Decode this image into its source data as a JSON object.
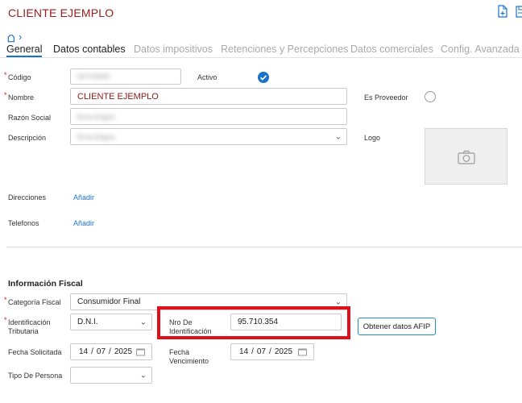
{
  "header": {
    "title": "CLIENTE EJEMPLO",
    "new_icon": "add-document-icon",
    "save_icon": "save-icon"
  },
  "breadcrumb": {
    "tag_icon": "tag-icon",
    "chevron": "›"
  },
  "tabs": [
    {
      "label": "General",
      "state": "active"
    },
    {
      "label": "Datos contables",
      "state": "enabled"
    },
    {
      "label": "Datos impositivos",
      "state": "disabled"
    },
    {
      "label": "Retenciones y Percepciones",
      "state": "disabled"
    },
    {
      "label": "Datos comerciales",
      "state": "disabled"
    },
    {
      "label": "Config. Avanzada",
      "state": "disabled"
    }
  ],
  "general": {
    "codigo": {
      "label": "Código",
      "value": "00723059"
    },
    "activo": {
      "label": "Activo",
      "checked": true
    },
    "nombre": {
      "label": "Nombre",
      "value": "CLIENTE EJEMPLO"
    },
    "es_proveedor": {
      "label": "Es Proveedor",
      "checked": false
    },
    "razon_social": {
      "label": "Razón Social",
      "value": "Ema Edgon"
    },
    "descripcion": {
      "label": "Descripción",
      "value": "Ema Edgon"
    },
    "logo": {
      "label": "Logo",
      "icon": "camera-icon"
    },
    "direcciones": {
      "label": "Direcciones",
      "action": "Añadir"
    },
    "telefonos": {
      "label": "Telefonos",
      "action": "Añadir"
    }
  },
  "fiscal": {
    "section_title": "Información Fiscal",
    "categoria": {
      "label": "Categoría Fiscal",
      "value": "Consumidor Final"
    },
    "identificacion": {
      "label_line1": "Identificación",
      "label_line2": "Tributaria",
      "value": "D.N.I."
    },
    "nro_identificacion": {
      "label_line1": "Nro De",
      "label_line2": "Identificación",
      "value": "95.710.354"
    },
    "afip_button": "Obtener datos AFIP",
    "fecha_solicitada": {
      "label": "Fecha Solicitada",
      "day": "14",
      "month": "07",
      "year": "2025"
    },
    "fecha_vencimiento": {
      "label_line1": "Fecha",
      "label_line2": "Vencimiento",
      "day": "14",
      "month": "07",
      "year": "2025"
    },
    "tipo_persona": {
      "label": "Tipo De Persona",
      "value": ""
    }
  },
  "colors": {
    "title": "#9a1b1b",
    "accent": "#1a73c9",
    "required": "#d01717",
    "highlight": "#e0101a"
  }
}
